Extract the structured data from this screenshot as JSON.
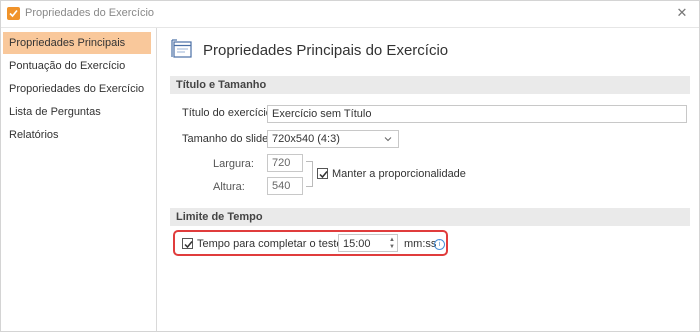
{
  "window": {
    "title": "Propriedades do Exercício",
    "close_glyph": "✕"
  },
  "sidebar": {
    "items": [
      {
        "label": "Propriedades Principais",
        "active": true
      },
      {
        "label": "Pontuação do Exercício",
        "active": false
      },
      {
        "label": "Proporiedades do Exercício",
        "active": false
      },
      {
        "label": "Lista de Perguntas",
        "active": false
      },
      {
        "label": "Relatórios",
        "active": false
      }
    ]
  },
  "main": {
    "header_title": "Propriedades Principais do Exercício",
    "header_icon": "properties-window-icon",
    "section_title_size": "Título e Tamanho",
    "title_label": "Título do exercício",
    "title_value": "Exercício sem Título",
    "size_label": "Tamanho do slide:",
    "size_value": "720x540 (4:3)",
    "width_label": "Largura:",
    "width_value": "720",
    "height_label": "Altura:",
    "height_value": "540",
    "keep_ratio_label": "Manter a proporcionalidade",
    "keep_ratio_checked": true,
    "section_time_limit": "Limite de Tempo",
    "time_checkbox_label": "Tempo para completar o teste:",
    "time_checked": true,
    "time_value": "15:00",
    "time_unit": "mm:ss"
  },
  "colors": {
    "accent": "#f0932b",
    "active_nav": "#f9c89b",
    "highlight_border": "#e03c3c",
    "info_blue": "#4a90d9"
  }
}
